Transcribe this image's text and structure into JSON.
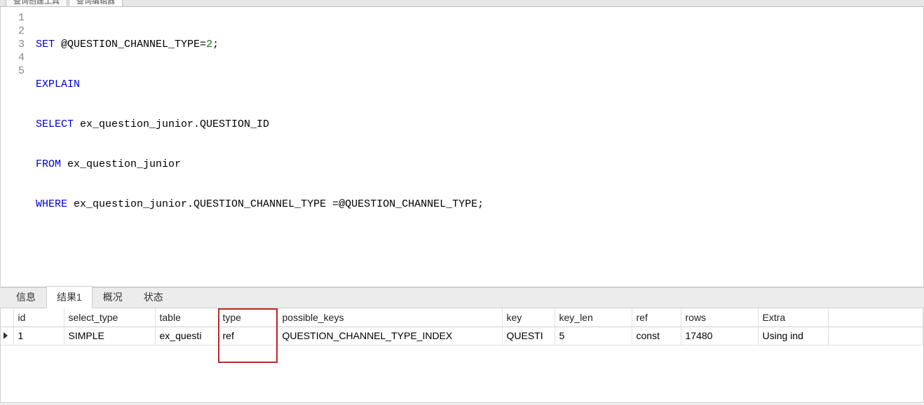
{
  "top_tabs": {
    "tab1": "查询创建工具",
    "tab2": "查询编辑器"
  },
  "sql": {
    "line1_kw1": "SET",
    "line1_rest": " @QUESTION_CHANNEL_TYPE=",
    "line1_num": "2",
    "line1_semi": ";",
    "line2_kw": "EXPLAIN",
    "line3_kw": "SELECT",
    "line3_rest": " ex_question_junior.QUESTION_ID",
    "line4_kw": "FROM",
    "line4_rest": " ex_question_junior",
    "line5_kw": "WHERE",
    "line5_rest": " ex_question_junior.QUESTION_CHANNEL_TYPE =@QUESTION_CHANNEL_TYPE;"
  },
  "gutter": [
    "1",
    "2",
    "3",
    "4",
    "5"
  ],
  "result_tabs": {
    "info": "信息",
    "result1": "结果1",
    "overview": "概况",
    "status": "状态"
  },
  "grid": {
    "headers": {
      "id": "id",
      "select_type": "select_type",
      "table": "table",
      "type": "type",
      "possible_keys": "possible_keys",
      "key": "key",
      "key_len": "key_len",
      "ref": "ref",
      "rows": "rows",
      "extra": "Extra"
    },
    "row1": {
      "id": "1",
      "select_type": "SIMPLE",
      "table": "ex_questi",
      "type": "ref",
      "possible_keys": "QUESTION_CHANNEL_TYPE_INDEX",
      "key": "QUESTI",
      "key_len": "5",
      "ref": "const",
      "rows": "17480",
      "extra": "Using ind"
    }
  }
}
